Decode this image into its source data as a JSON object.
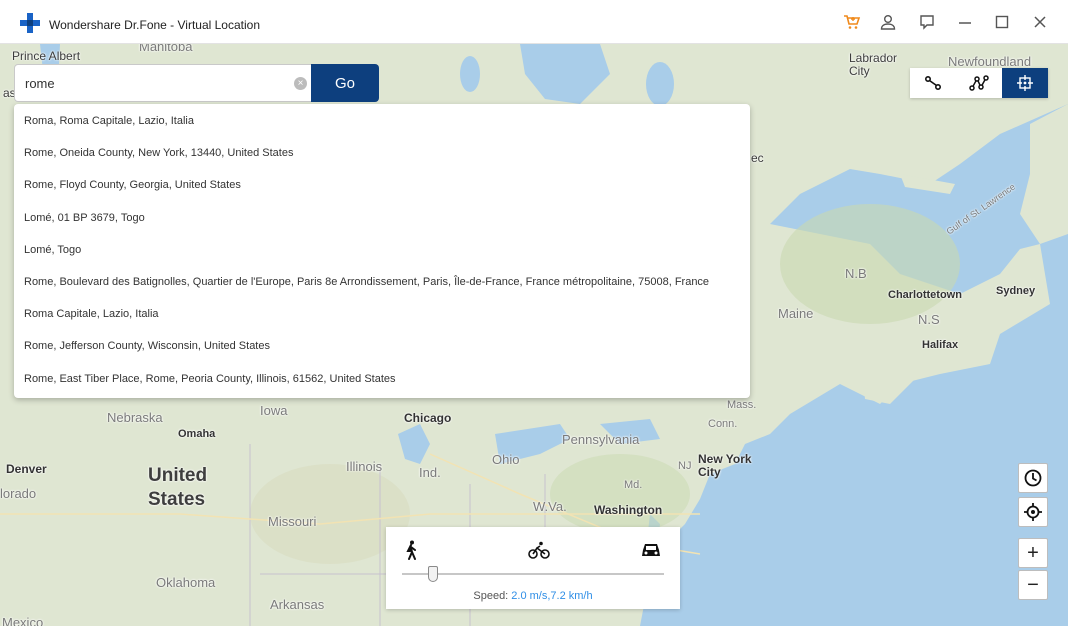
{
  "window": {
    "title": "Wondershare Dr.Fone - Virtual Location",
    "icons": [
      "cart-icon",
      "user-icon",
      "feedback-icon",
      "minimize-icon",
      "maximize-icon",
      "close-icon"
    ]
  },
  "search": {
    "value": "rome",
    "go_label": "Go",
    "suggestions": [
      "Roma, Roma Capitale, Lazio, Italia",
      "Rome, Oneida County, New York, 13440, United States",
      "Rome, Floyd County, Georgia, United States",
      "Lomé, 01 BP 3679, Togo",
      "Lomé, Togo",
      "Rome, Boulevard des Batignolles, Quartier de l'Europe, Paris 8e Arrondissement, Paris, Île-de-France, France métropolitaine, 75008, France",
      "Roma Capitale, Lazio, Italia",
      "Rome, Jefferson County, Wisconsin, United States",
      "Rome, East Tiber Place, Rome, Peoria County, Illinois, 61562, United States"
    ]
  },
  "modes": {
    "items": [
      "two-stop-mode-icon",
      "multi-stop-mode-icon",
      "teleport-mode-icon"
    ],
    "active": "teleport-mode-icon"
  },
  "map_labels": {
    "prince_albert": "Prince Albert",
    "manitoba": "Manitoba",
    "labrador_city": "Labrador City",
    "newfoundland": "Newfoundland",
    "gulf": "Gulf of St. Lawrence",
    "nb": "N.B",
    "ns": "N.S",
    "maine": "Maine",
    "charlottetown": "Charlottetown",
    "sydney": "Sydney",
    "halifax": "Halifax",
    "nebraska": "Nebraska",
    "iowa": "Iowa",
    "omaha": "Omaha",
    "chicago": "Chicago",
    "mass": "Mass.",
    "conn": "Conn.",
    "pennsylvania": "Pennsylvania",
    "denver": "Denver",
    "colorado": "lorado",
    "united_states": "United States",
    "illinois": "Illinois",
    "ind": "Ind.",
    "ohio": "Ohio",
    "nj": "NJ",
    "new_york_city": "New York City",
    "md": "Md.",
    "wva": "W.Va.",
    "washington": "Washington",
    "missouri": "Missouri",
    "oklahoma": "Oklahoma",
    "arkansas": "Arkansas",
    "mexico": "Mexico",
    "ec": "ec",
    "sas": "as"
  },
  "controls": {
    "zoom_in": "+",
    "zoom_out": "−"
  },
  "speed": {
    "label": "Speed: ",
    "value": "2.0 m/s,7.2 km/h",
    "slider_fraction": 0.12,
    "modes": [
      "walk-icon",
      "bike-icon",
      "car-icon"
    ]
  },
  "colors": {
    "accent": "#0d3f7e",
    "water": "#a9cde9",
    "land": "#dfe6d2",
    "speed_value": "#2f8ee6",
    "cart": "#f08a1c"
  }
}
